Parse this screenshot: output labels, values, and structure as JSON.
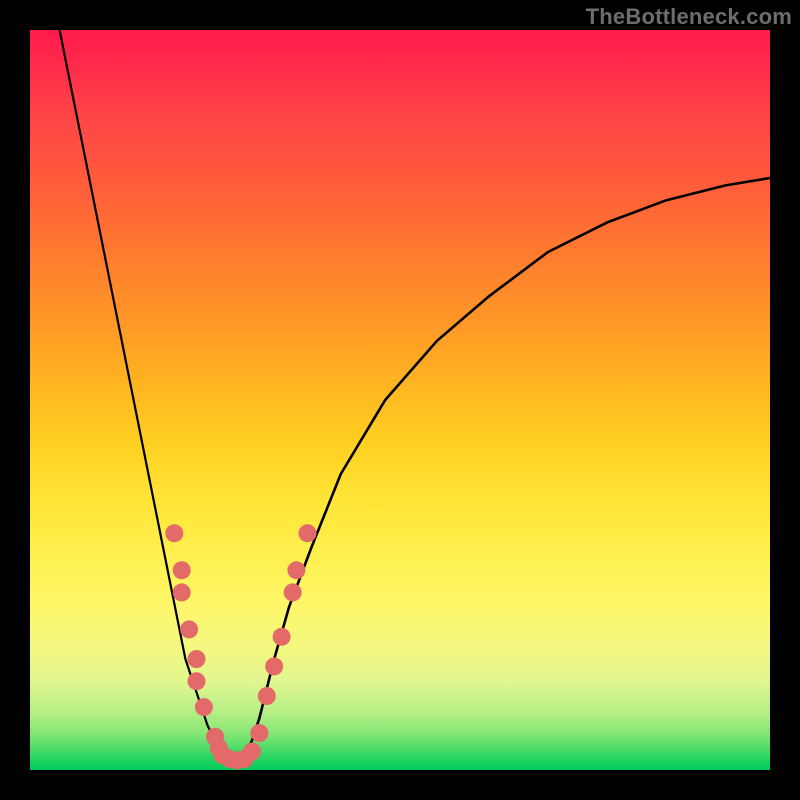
{
  "watermark": "TheBottleneck.com",
  "colors": {
    "frame": "#000000",
    "watermark_text": "#6d6d6d",
    "dot_fill": "#e46a6a",
    "curve_stroke": "#000000",
    "gradient_top": "#ff1a4c",
    "gradient_bottom": "#00c95c"
  },
  "chart_data": {
    "type": "line",
    "title": "",
    "xlabel": "",
    "ylabel": "",
    "xlim": [
      0,
      100
    ],
    "ylim": [
      0,
      100
    ],
    "grid": false,
    "legend": false,
    "series": [
      {
        "name": "left-curve",
        "x": [
          4,
          6,
          8,
          10,
          12,
          14,
          16,
          18,
          20,
          21,
          22,
          23,
          24,
          25,
          26,
          27,
          28
        ],
        "y": [
          100,
          90,
          80,
          70,
          60,
          50,
          40,
          30,
          20,
          15,
          12,
          9,
          6,
          4,
          2.5,
          1.5,
          1
        ]
      },
      {
        "name": "right-curve",
        "x": [
          28,
          29,
          30,
          31,
          32,
          33,
          35,
          38,
          42,
          48,
          55,
          62,
          70,
          78,
          86,
          94,
          100
        ],
        "y": [
          1,
          2,
          4,
          7,
          11,
          15,
          22,
          30,
          40,
          50,
          58,
          64,
          70,
          74,
          77,
          79,
          80
        ]
      }
    ],
    "scatter_points": [
      {
        "x": 19.5,
        "y": 32
      },
      {
        "x": 20.5,
        "y": 27
      },
      {
        "x": 20.5,
        "y": 24
      },
      {
        "x": 21.5,
        "y": 19
      },
      {
        "x": 22.5,
        "y": 15
      },
      {
        "x": 22.5,
        "y": 12
      },
      {
        "x": 23.5,
        "y": 8.5
      },
      {
        "x": 25.0,
        "y": 4.5
      },
      {
        "x": 25.5,
        "y": 3
      },
      {
        "x": 26.0,
        "y": 2
      },
      {
        "x": 27.0,
        "y": 1.5
      },
      {
        "x": 28.0,
        "y": 1.3
      },
      {
        "x": 29.0,
        "y": 1.5
      },
      {
        "x": 30.0,
        "y": 2.5
      },
      {
        "x": 31.0,
        "y": 5
      },
      {
        "x": 32.0,
        "y": 10
      },
      {
        "x": 33.0,
        "y": 14
      },
      {
        "x": 34.0,
        "y": 18
      },
      {
        "x": 35.5,
        "y": 24
      },
      {
        "x": 36.0,
        "y": 27
      },
      {
        "x": 37.5,
        "y": 32
      }
    ],
    "annotations": []
  }
}
